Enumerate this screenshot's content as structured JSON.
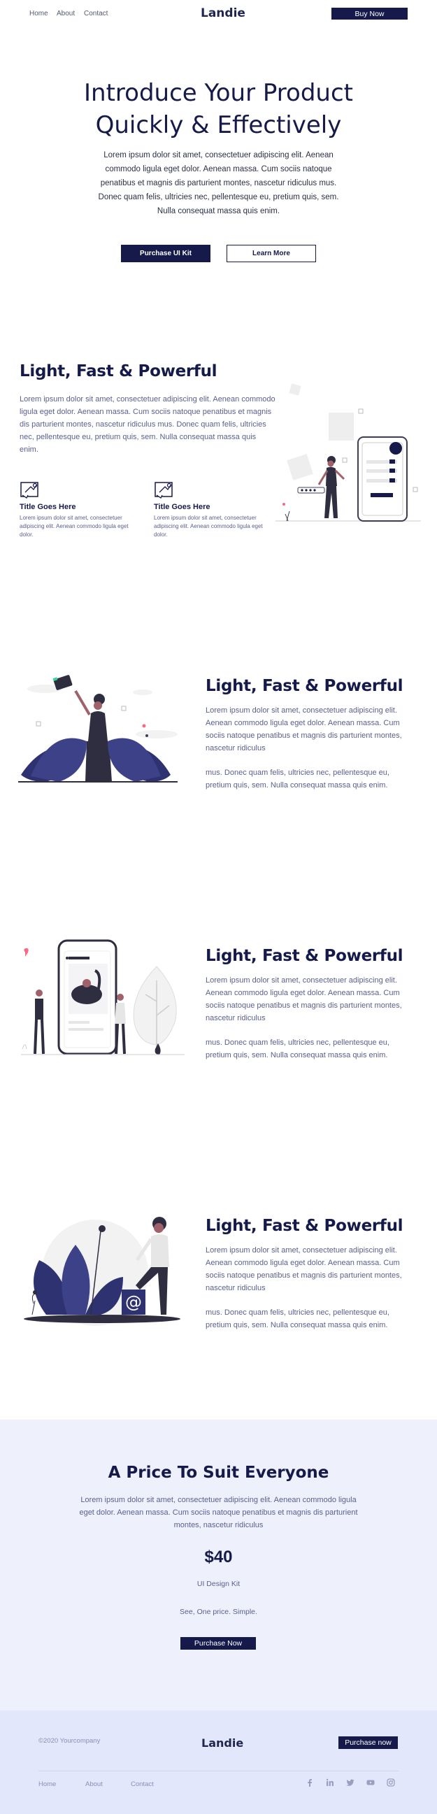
{
  "nav": {
    "links": [
      "Home",
      "About",
      "Contact"
    ],
    "logo": "Landie",
    "cta": "Buy Now"
  },
  "hero": {
    "title_line1": "Introduce Your Product",
    "title_line2": "Quickly & Effectively",
    "text": "Lorem ipsum dolor sit amet, consectetuer adipiscing elit. Aenean commodo ligula eget dolor. Aenean massa. Cum sociis natoque penatibus et magnis dis parturient montes, nascetur ridiculus mus. Donec quam felis, ultricies nec, pellentesque eu, pretium quis, sem. Nulla consequat massa quis enim.",
    "primary_button": "Purchase UI Kit",
    "secondary_button": "Learn More"
  },
  "features": {
    "title": "Light, Fast & Powerful",
    "text": "Lorem ipsum dolor sit amet, consectetuer adipiscing elit. Aenean commodo ligula eget dolor. Aenean massa. Cum sociis natoque penatibus et magnis dis parturient montes, nascetur ridiculus mus. Donec quam felis, ultricies nec, pellentesque eu, pretium quis, sem. Nulla consequat massa quis enim.",
    "items": [
      {
        "icon": "megaphone-board-icon",
        "title": "Title Goes Here",
        "text": "Lorem ipsum dolor sit amet, consectetuer adipiscing elit. Aenean commodo ligula eget dolor."
      },
      {
        "icon": "megaphone-board-icon",
        "title": "Title Goes Here",
        "text": "Lorem ipsum dolor sit amet, consectetuer adipiscing elit. Aenean commodo ligula eget dolor."
      }
    ]
  },
  "sections": [
    {
      "title": "Light, Fast & Powerful",
      "text1": "Lorem ipsum dolor sit amet, consectetuer adipiscing elit. Aenean commodo ligula eget dolor. Aenean massa. Cum sociis natoque penatibus et magnis dis parturient montes, nascetur ridiculus",
      "text2": "mus. Donec quam felis, ultricies nec, pellentesque eu, pretium quis, sem. Nulla consequat massa quis enim."
    },
    {
      "title": "Light, Fast & Powerful",
      "text1": "Lorem ipsum dolor sit amet, consectetuer adipiscing elit. Aenean commodo ligula eget dolor. Aenean massa. Cum sociis natoque penatibus et magnis dis parturient montes, nascetur ridiculus",
      "text2": "mus. Donec quam felis, ultricies nec, pellentesque eu, pretium quis, sem. Nulla consequat massa quis enim."
    },
    {
      "title": "Light, Fast & Powerful",
      "text1": "Lorem ipsum dolor sit amet, consectetuer adipiscing elit. Aenean commodo ligula eget dolor. Aenean massa. Cum sociis natoque penatibus et magnis dis parturient montes, nascetur ridiculus",
      "text2": "mus. Donec quam felis, ultricies nec, pellentesque eu, pretium quis, sem. Nulla consequat massa quis enim."
    }
  ],
  "pricing": {
    "title": "A Price To Suit Everyone",
    "text": "Lorem ipsum dolor sit amet, consectetuer adipiscing elit. Aenean commodo ligula eget dolor. Aenean massa. Cum sociis natoque penatibus et magnis dis parturient montes, nascetur ridiculus",
    "price": "$40",
    "product": "UI Design Kit",
    "tagline": "See, One price. Simple.",
    "button": "Purchase Now"
  },
  "footer": {
    "copyright": "©2020 Yourcompany",
    "logo": "Landie",
    "button": "Purchase now",
    "links": [
      "Home",
      "About",
      "Contact"
    ],
    "social_icons": [
      "facebook-icon",
      "linkedin-icon",
      "twitter-icon",
      "youtube-icon",
      "instagram-icon"
    ]
  },
  "colors": {
    "navy": "#151a4a",
    "text": "#5a5f8e",
    "pricing_bg": "#eef0fb",
    "footer_bg": "#e3e7fb"
  }
}
